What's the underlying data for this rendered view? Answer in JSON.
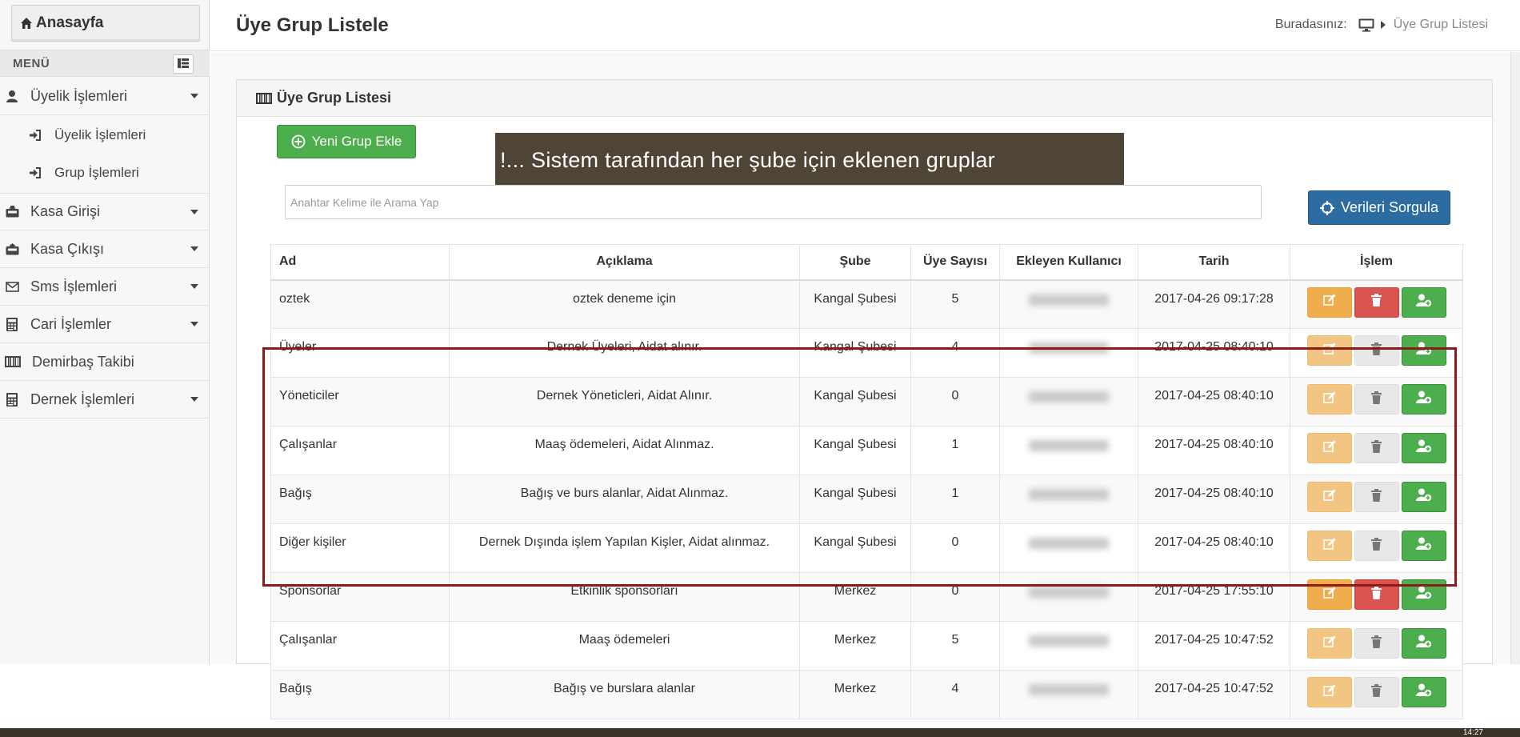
{
  "sidebar": {
    "home_label": "Anasayfa",
    "menu_label": "MENÜ",
    "items": [
      {
        "label": "Üyelik İşlemleri",
        "icon": "user-icon",
        "has_caret": true
      },
      {
        "label": "Üyelik İşlemleri",
        "icon": "sign-in-icon",
        "sub": true
      },
      {
        "label": "Grup İşlemleri",
        "icon": "sign-in-icon",
        "sub": true
      },
      {
        "label": "Kasa Girişi",
        "icon": "inbox-in-icon",
        "has_caret": true
      },
      {
        "label": "Kasa Çıkışı",
        "icon": "inbox-out-icon",
        "has_caret": true
      },
      {
        "label": "Sms İşlemleri",
        "icon": "envelope-icon",
        "has_caret": true
      },
      {
        "label": "Cari İşlemler",
        "icon": "calculator-icon",
        "has_caret": true
      },
      {
        "label": "Demirbaş Takibi",
        "icon": "barcode-icon",
        "has_caret": false
      },
      {
        "label": "Dernek İşlemleri",
        "icon": "calculator-icon",
        "has_caret": true
      }
    ]
  },
  "header": {
    "title": "Üye Grup Listele",
    "breadcrumb_prefix": "Buradasınız:",
    "breadcrumb_current": "Üye Grup Listesi"
  },
  "panel": {
    "title": "Üye Grup Listesi",
    "new_button": "Yeni Grup Ekle",
    "notice": "!... Sistem tarafından her şube için eklenen gruplar",
    "search_placeholder": "Anahtar Kelime ile Arama Yap",
    "query_button": "Verileri Sorgula"
  },
  "table": {
    "headers": [
      "Ad",
      "Açıklama",
      "Şube",
      "Üye Sayısı",
      "Ekleyen Kullanıcı",
      "Tarih",
      "İşlem"
    ],
    "rows": [
      {
        "ad": "oztek",
        "aciklama": "oztek deneme için",
        "sube": "Kangal Şubesi",
        "uye": "5",
        "tarih": "2017-04-26 09:17:28",
        "deletable": true
      },
      {
        "ad": "Üyeler",
        "aciklama": "Dernek Üyeleri, Aidat alınır.",
        "sube": "Kangal Şubesi",
        "uye": "4",
        "tarih": "2017-04-25 08:40:10",
        "deletable": false
      },
      {
        "ad": "Yöneticiler",
        "aciklama": "Dernek Yöneticleri, Aidat Alınır.",
        "sube": "Kangal Şubesi",
        "uye": "0",
        "tarih": "2017-04-25 08:40:10",
        "deletable": false
      },
      {
        "ad": "Çalışanlar",
        "aciklama": "Maaş ödemeleri, Aidat Alınmaz.",
        "sube": "Kangal Şubesi",
        "uye": "1",
        "tarih": "2017-04-25 08:40:10",
        "deletable": false
      },
      {
        "ad": "Bağış",
        "aciklama": "Bağış ve burs alanlar, Aidat Alınmaz.",
        "sube": "Kangal Şubesi",
        "uye": "1",
        "tarih": "2017-04-25 08:40:10",
        "deletable": false
      },
      {
        "ad": "Diğer kişiler",
        "aciklama": "Dernek Dışında işlem Yapılan Kişler, Aidat alınmaz.",
        "sube": "Kangal Şubesi",
        "uye": "0",
        "tarih": "2017-04-25 08:40:10",
        "deletable": false
      },
      {
        "ad": "Sponsorlar",
        "aciklama": "Etkinlik sponsorları",
        "sube": "Merkez",
        "uye": "0",
        "tarih": "2017-04-25 17:55:10",
        "deletable": true
      },
      {
        "ad": "Çalışanlar",
        "aciklama": "Maaş ödemeleri",
        "sube": "Merkez",
        "uye": "5",
        "tarih": "2017-04-25 10:47:52",
        "deletable": false
      },
      {
        "ad": "Bağış",
        "aciklama": "Bağış ve burslara alanlar",
        "sube": "Merkez",
        "uye": "4",
        "tarih": "2017-04-25 10:47:52",
        "deletable": false
      }
    ]
  },
  "taskbar": {
    "time": "14:27"
  },
  "colors": {
    "success": "#4cae4c",
    "primary": "#2d6ca2",
    "warning": "#f0ad4e",
    "danger": "#d9534f",
    "notice_bg": "#4e4536",
    "highlight": "#8b1a1a"
  }
}
